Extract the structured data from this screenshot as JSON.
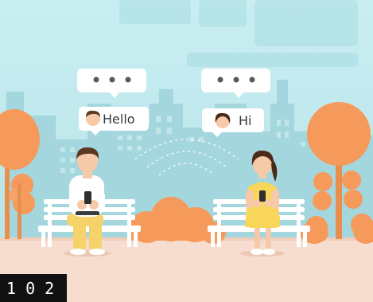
{
  "scene": {
    "left_message": "Hello",
    "right_message": "Hi",
    "frame_counter": "1 0 2",
    "colors": {
      "sky": "#bfe8ec",
      "buildings": "#9fd4dc",
      "ground": "#f7ddcf",
      "tree": "#f59a5a",
      "bench": "#ffffff",
      "girl_dress": "#f8d65a",
      "boy_pants": "#f6d36a"
    }
  }
}
